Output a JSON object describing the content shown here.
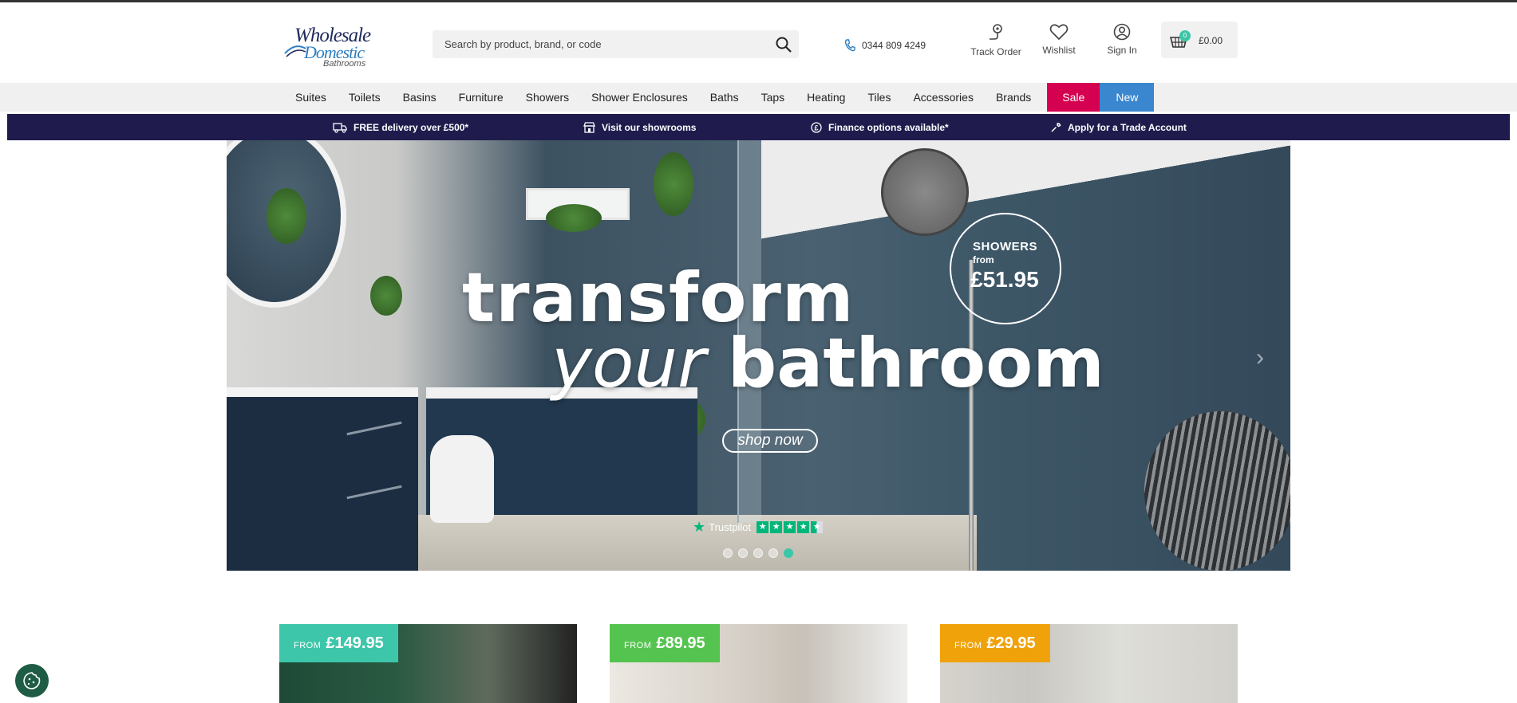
{
  "logo": {
    "line1": "Wholesale",
    "line2": "Domestic",
    "line3": "Bathrooms"
  },
  "search": {
    "placeholder": "Search by product, brand, or code"
  },
  "phone": {
    "number": "0344 809 4249"
  },
  "header_links": {
    "track": "Track Order",
    "wishlist": "Wishlist",
    "signin": "Sign In"
  },
  "basket": {
    "count": "0",
    "total": "£0.00"
  },
  "nav": {
    "items": [
      "Suites",
      "Toilets",
      "Basins",
      "Furniture",
      "Showers",
      "Shower Enclosures",
      "Baths",
      "Taps",
      "Heating",
      "Tiles",
      "Accessories",
      "Brands"
    ],
    "sale": "Sale",
    "new": "New"
  },
  "usp": {
    "delivery": "FREE delivery over £500*",
    "showrooms": "Visit our showrooms",
    "finance": "Finance options available*",
    "trade": "Apply for a Trade Account"
  },
  "hero": {
    "line1": "transform",
    "line2_italic": "your",
    "line2_bold": "bathroom",
    "cta": "shop now",
    "badge_title": "SHOWERS",
    "badge_from": "from",
    "badge_price": "£51.95",
    "trustpilot": "Trustpilot",
    "slide_count": 5,
    "active_slide": 5
  },
  "cards": [
    {
      "from": "FROM",
      "price": "£149.95"
    },
    {
      "from": "FROM",
      "price": "£89.95"
    },
    {
      "from": "FROM",
      "price": "£29.95"
    }
  ],
  "colors": {
    "usp_bar": "#1f1c4d",
    "sale": "#d5004f",
    "new": "#3a87cf",
    "accent_teal": "#3cc6a8",
    "card1": "#3dc6a9",
    "card2": "#55c34f",
    "card3": "#f0a20a"
  },
  "icons": [
    "search-icon",
    "phone-icon",
    "track-order-icon",
    "heart-icon",
    "user-icon",
    "basket-icon",
    "delivery-truck-icon",
    "store-icon",
    "pound-icon",
    "wrench-icon",
    "cookie-icon",
    "chevron-right-icon"
  ]
}
